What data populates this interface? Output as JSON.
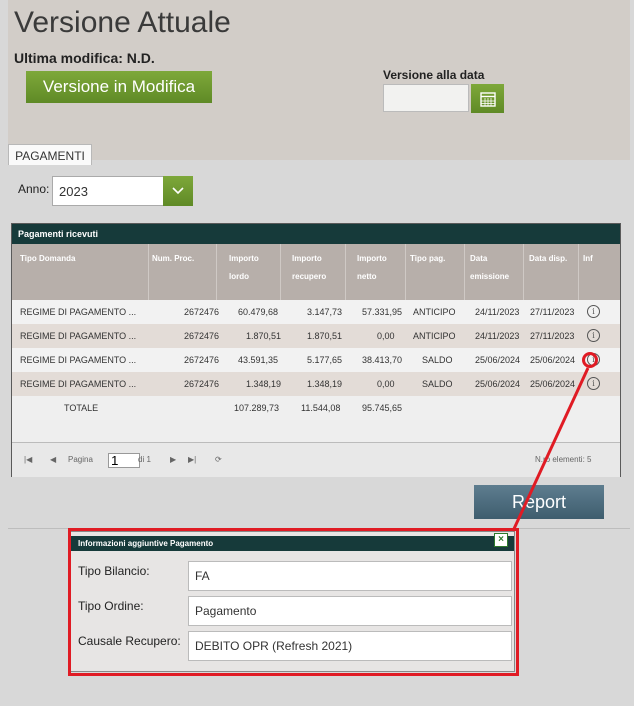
{
  "header": {
    "title": "Versione Attuale",
    "last_modified": "Ultima modifica: N.D.",
    "edit_button": "Versione in Modifica",
    "date_label": "Versione alla data",
    "date_value": ""
  },
  "tabs": [
    {
      "label": "PAGAMENTI"
    }
  ],
  "filter": {
    "year_label": "Anno:",
    "year_value": "2023"
  },
  "grid": {
    "title": "Pagamenti ricevuti",
    "headers": {
      "tipo_domanda": "Tipo Domanda",
      "num_proc": "Num. Proc.",
      "importo_lordo": [
        "Importo",
        "lordo"
      ],
      "importo_recupero": [
        "Importo",
        "recupero"
      ],
      "importo_netto": [
        "Importo",
        "netto"
      ],
      "tipo_pag": "Tipo pag.",
      "data_emissione": [
        "Data",
        "emissione"
      ],
      "data_disp": "Data disp.",
      "inf": "Inf"
    },
    "rows": [
      {
        "tipo": "REGIME DI PAGAMENTO ...",
        "num": "2672476",
        "lordo": "60.479,68",
        "recupero": "3.147,73",
        "netto": "57.331,95",
        "tipo_pag": "ANTICIPO",
        "emissione": "24/11/2023",
        "disp": "27/11/2023"
      },
      {
        "tipo": "REGIME DI PAGAMENTO ...",
        "num": "2672476",
        "lordo": "1.870,51",
        "recupero": "1.870,51",
        "netto": "0,00",
        "tipo_pag": "ANTICIPO",
        "emissione": "24/11/2023",
        "disp": "27/11/2023"
      },
      {
        "tipo": "REGIME DI PAGAMENTO ...",
        "num": "2672476",
        "lordo": "43.591,35",
        "recupero": "5.177,65",
        "netto": "38.413,70",
        "tipo_pag": "SALDO",
        "emissione": "25/06/2024",
        "disp": "25/06/2024"
      },
      {
        "tipo": "REGIME DI PAGAMENTO ...",
        "num": "2672476",
        "lordo": "1.348,19",
        "recupero": "1.348,19",
        "netto": "0,00",
        "tipo_pag": "SALDO",
        "emissione": "25/06/2024",
        "disp": "25/06/2024"
      }
    ],
    "totals": {
      "label": "TOTALE",
      "lordo": "107.289,73",
      "recupero": "11.544,08",
      "netto": "95.745,65"
    },
    "info_glyph": "i",
    "pager": {
      "page_label": "Pagina",
      "page_value": "1",
      "of_label": "di 1",
      "count": "N.ro elementi: 5"
    }
  },
  "report_button": "Report",
  "popup": {
    "title": "Informazioni aggiuntive Pagamento",
    "close": "×",
    "fields": [
      {
        "label": "Tipo Bilancio:",
        "value": "FA"
      },
      {
        "label": "Tipo Ordine:",
        "value": "Pagamento"
      },
      {
        "label": "Causale Recupero:",
        "value": "DEBITO OPR  (Refresh 2021)"
      }
    ]
  },
  "colors": {
    "green": "#6a962e",
    "dark_teal": "#163a3a",
    "header_gray": "#b7afaa",
    "annotation_red": "#e01b24"
  }
}
